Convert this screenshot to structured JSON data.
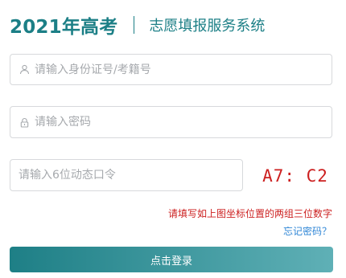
{
  "header": {
    "title": "2021年高考",
    "subtitle": "志愿填报服务系统"
  },
  "form": {
    "id_field": {
      "placeholder": "请输入身份证号/考籍号",
      "value": "",
      "icon": "user-icon"
    },
    "password_field": {
      "placeholder": "请输入密码",
      "value": "",
      "icon": "lock-icon"
    },
    "code_field": {
      "placeholder": "请输入6位动态口令",
      "value": ""
    },
    "captcha_text": "A7: C2",
    "hint": "请填写如上图坐标位置的两组三位数字",
    "forgot_link": "忘记密码？",
    "login_button": "点击登录"
  },
  "colors": {
    "accent": "#1c7f86",
    "error_red": "#cc1f1f",
    "link_blue": "#2f86d6",
    "button_gradient_start": "#1e7f86",
    "button_gradient_end": "#5fb0b6"
  }
}
